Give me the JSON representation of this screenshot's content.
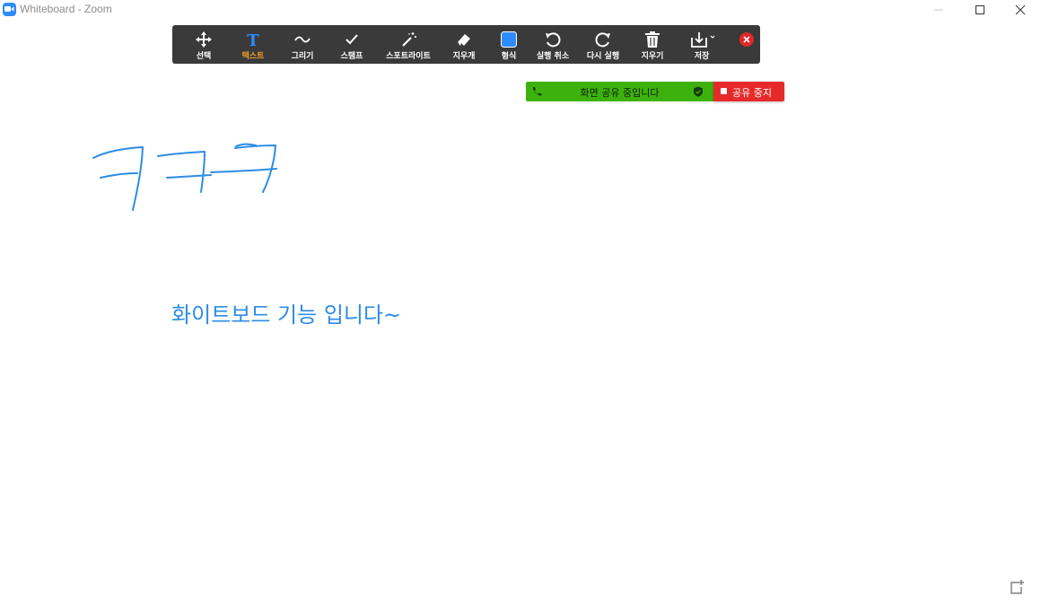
{
  "window": {
    "title": "Whiteboard - Zoom",
    "app_icon": "zoom-camera-icon"
  },
  "toolbar": {
    "tools": [
      {
        "label": "선택",
        "icon": "move-arrows-icon"
      },
      {
        "label": "텍스트",
        "icon": "text-t-icon",
        "active": true
      },
      {
        "label": "그리기",
        "icon": "tilde-draw-icon"
      },
      {
        "label": "스탬프",
        "icon": "checkmark-stamp-icon"
      },
      {
        "label": "스포트라이트",
        "icon": "magic-wand-icon"
      },
      {
        "label": "지우개",
        "icon": "eraser-icon"
      },
      {
        "label": "형식",
        "icon": "format-color-square-icon"
      },
      {
        "label": "실행 취소",
        "icon": "undo-icon"
      },
      {
        "label": "다시 실행",
        "icon": "redo-icon"
      },
      {
        "label": "지우기",
        "icon": "trash-icon"
      },
      {
        "label": "저장",
        "icon": "save-download-icon"
      }
    ],
    "active_label_color": "#f0a030",
    "format_swatch_color": "#2d8cff"
  },
  "share": {
    "status": "화면 공유 중입니다",
    "stop_label": "공유 중지",
    "status_color": "#3db20e",
    "stop_color": "#e62a2a"
  },
  "canvas": {
    "handwriting_strokes": "hand-drawn blue strokes (ㅋㅋㅋ)",
    "text": "화이트보드 기능 입니다~",
    "ink_color": "#2d8ce6"
  }
}
